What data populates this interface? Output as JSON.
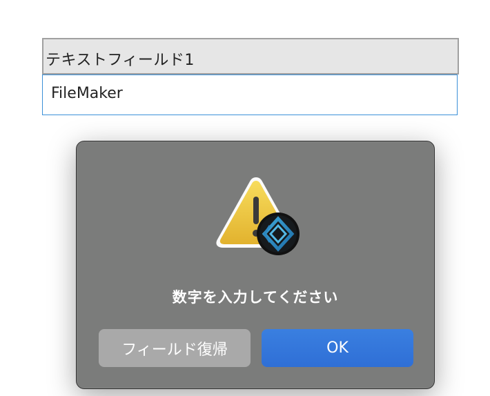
{
  "field": {
    "label": "テキストフィールド1",
    "value": "FileMaker"
  },
  "dialog": {
    "icons": [
      "warning-triangle-icon",
      "filemaker-app-icon"
    ],
    "message": "数字を入力してください",
    "buttons": {
      "revert_label": "フィールド復帰",
      "ok_label": "OK"
    }
  },
  "colors": {
    "field_border_focus": "#3a8fd8",
    "dialog_bg": "#7b7c7b",
    "ok_button": "#2f6fd6",
    "revert_button": "#a9a9a9"
  }
}
